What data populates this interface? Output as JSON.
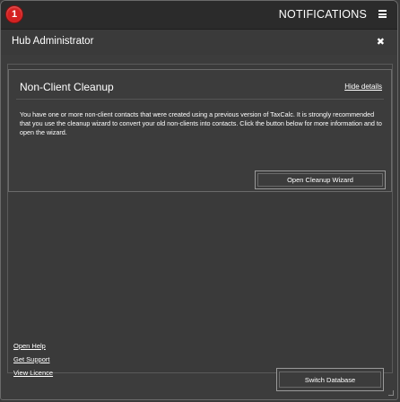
{
  "header": {
    "badge_count": "1",
    "title": "NOTIFICATIONS",
    "menu_icon": "hamburger-menu-icon"
  },
  "subheader": {
    "title": "Hub Administrator",
    "close_label": "✖"
  },
  "notification": {
    "title": "Non-Client Cleanup",
    "hide_details_label": "Hide details",
    "body": "You have one or more non-client contacts that were created using a previous version of TaxCalc. It is strongly recommended that you use the cleanup wizard to convert your old non-clients into contacts. Click the button below for more information and to open the wizard.",
    "button_label": "Open Cleanup Wizard"
  },
  "footer": {
    "links": [
      "Open Help",
      "Get Support",
      "View Licence"
    ],
    "switch_button_label": "Switch Database"
  },
  "colors": {
    "badge": "#d42020",
    "background": "#3a3a3a",
    "topbar": "#2b2b2b",
    "text": "#ffffff"
  }
}
